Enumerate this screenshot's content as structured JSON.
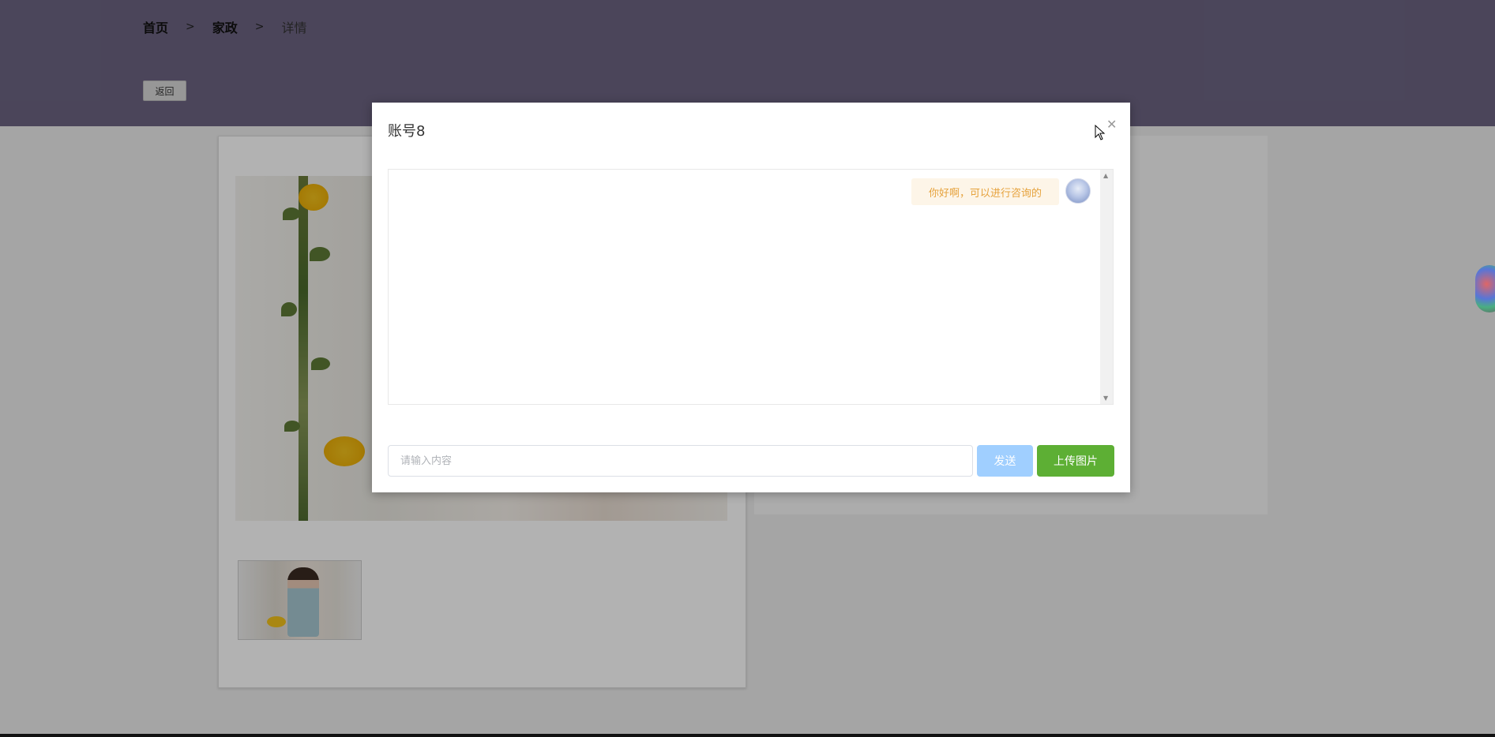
{
  "breadcrumb": {
    "home": "首页",
    "separator": ">",
    "category": "家政",
    "current": "详情"
  },
  "back_button": {
    "label": "返回"
  },
  "dialog": {
    "title": "账号8",
    "close_icon": "close-icon",
    "messages": [
      {
        "text": "你好啊，可以进行咨询的",
        "side": "right"
      }
    ],
    "input": {
      "value": "",
      "placeholder": "请输入内容"
    },
    "send_label": "发送",
    "upload_label": "上传图片"
  },
  "colors": {
    "header_bg": "#6c6482",
    "send_disabled": "#a0cfff",
    "upload": "#5daf34",
    "bubble_bg": "#fdf5e8",
    "bubble_text": "#e6a23c"
  }
}
